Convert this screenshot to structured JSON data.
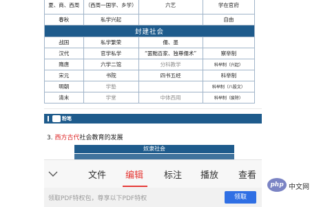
{
  "table": {
    "rows": [
      {
        "cells": [
          "夏、商、西周",
          "（西周一国学、乡学）",
          "六艺",
          "学在官府"
        ],
        "kind": "first"
      },
      {
        "cells": [
          "春秋",
          "私学兴起",
          "",
          "自由"
        ]
      },
      {
        "section": "封建社会"
      },
      {
        "cells": [
          "战国",
          "私学繁荣",
          "儒、墨",
          ""
        ]
      },
      {
        "cells": [
          "汉代",
          "官学私学",
          "“罢黜百家、独尊儒术”",
          "察举制"
        ]
      },
      {
        "cells": [
          "隋唐",
          "六学二馆",
          "分科教学",
          "科举制（兴起）"
        ]
      },
      {
        "cells": [
          "宋元",
          "书院",
          "四书五经",
          "科举制"
        ]
      },
      {
        "cells": [
          "明朝",
          "学塾",
          "",
          "科举制（八股文）"
        ]
      },
      {
        "cells": [
          "清末",
          "学堂",
          "中体西用",
          "科举制（废除）"
        ]
      }
    ]
  },
  "banner": {
    "label": "粉笔"
  },
  "item3": {
    "num": "3.",
    "highlight": "西方古代",
    "rest": "社会教育的发展"
  },
  "sub_table": {
    "header": "奴隶社会"
  },
  "toolbar": {
    "items": [
      {
        "label": "文件"
      },
      {
        "label": "编辑",
        "active": true
      },
      {
        "label": "标注"
      },
      {
        "label": "播放"
      },
      {
        "label": "查看"
      }
    ]
  },
  "promo": {
    "text": "领取PDF特权包，尊享以下PDF特权",
    "button": "领取"
  },
  "watermark": {
    "logo": "php",
    "text": "中文网"
  },
  "colors": {
    "section_blue": "#1e5b8c",
    "accent_red": "#e53935",
    "button_blue": "#2f6fe4"
  }
}
